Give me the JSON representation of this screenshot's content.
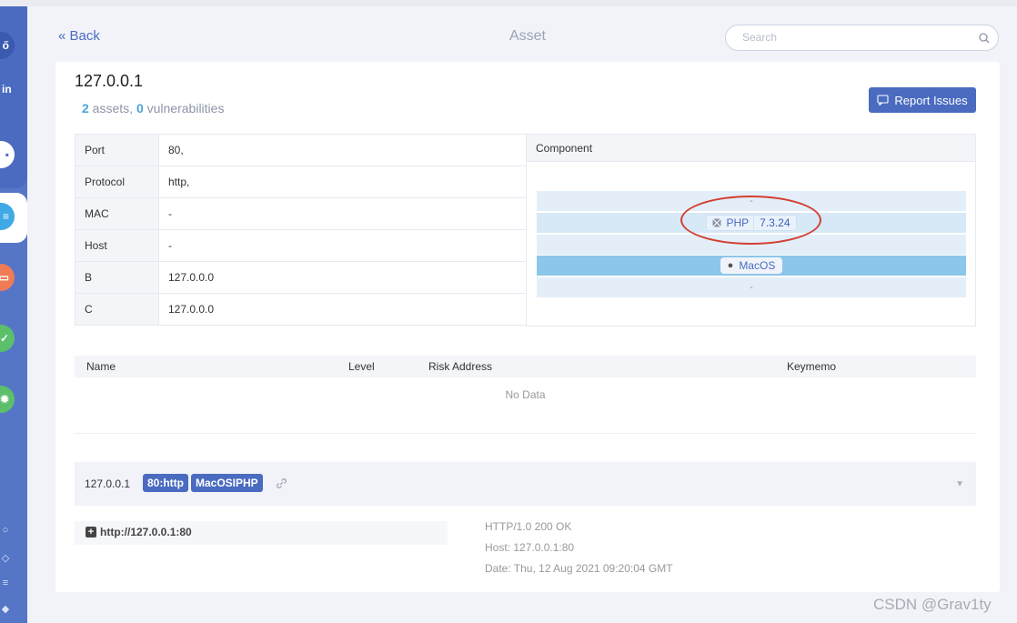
{
  "header": {
    "back_label": "« Back",
    "title": "Asset",
    "search_placeholder": "Search"
  },
  "sidebar": {
    "partial_text": "in",
    "icon_colors": [
      "#ffffff",
      "#3fa9e5",
      "#f07b56",
      "#5cbf6a",
      "#5cbf6a"
    ]
  },
  "asset": {
    "ip": "127.0.0.1",
    "asset_count": "2",
    "assets_text": " assets, ",
    "vuln_count": "0",
    "vulns_text": " vulnerabilities",
    "report_button": "Report Issues"
  },
  "info": [
    {
      "key": "Port",
      "value": "80,"
    },
    {
      "key": "Protocol",
      "value": "http,"
    },
    {
      "key": "MAC",
      "value": "-"
    },
    {
      "key": "Host",
      "value": "-"
    },
    {
      "key": "B",
      "value": "127.0.0.0"
    },
    {
      "key": "C",
      "value": "127.0.0.0"
    }
  ],
  "component": {
    "heading": "Component",
    "row1": "-",
    "php_name": "PHP",
    "php_version": "7.3.24",
    "os_name": "MacOS",
    "row5": "-"
  },
  "vulns": {
    "columns": [
      "Name",
      "Level",
      "Risk Address",
      "Keymemo"
    ],
    "empty_text": "No Data"
  },
  "service": {
    "ip": "127.0.0.1",
    "port_tag": "80:http",
    "tech_tag": "MacOSIPHP",
    "url": "http://127.0.0.1:80",
    "response_lines": [
      "HTTP/1.0 200 OK",
      "Host: 127.0.0.1:80",
      "Date: Thu, 12 Aug 2021 09:20:04 GMT"
    ]
  },
  "watermark": "CSDN @Grav1ty",
  "colors": {
    "accent": "#4a6bc0",
    "annotation": "#d33f32"
  }
}
